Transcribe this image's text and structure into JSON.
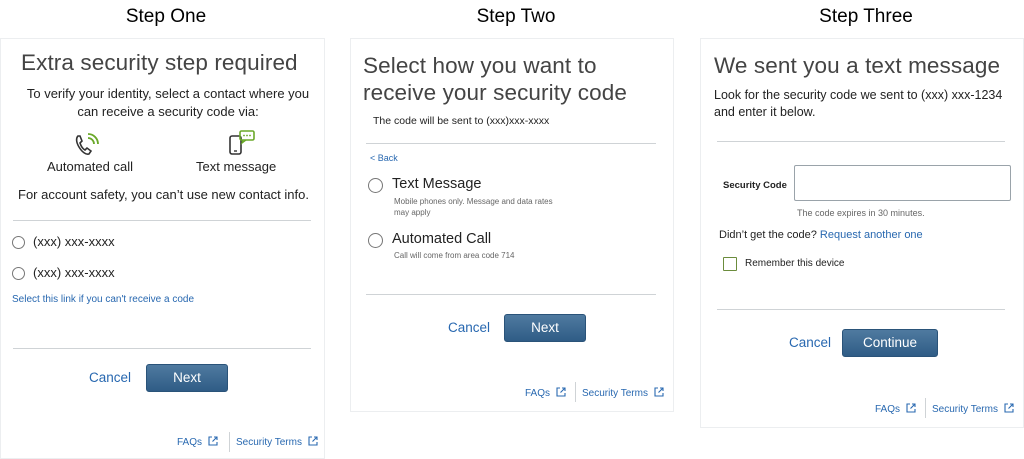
{
  "headings": {
    "step1": "Step One",
    "step2": "Step Two",
    "step3": "Step Three"
  },
  "step1": {
    "title": "Extra security step required",
    "intro": "To verify your identity, select a contact where you can receive a security code via:",
    "call_label": "Automated call",
    "text_label": "Text message",
    "safety_note": "For account safety, you can’t use new contact info.",
    "contact1": "(xxx) xxx-xxxx",
    "contact2": "(xxx) xxx-xxxx",
    "cant_receive_link": "Select this link if you can't receive a code",
    "cancel": "Cancel",
    "next": "Next",
    "faqs": "FAQs",
    "security_terms": "Security Terms"
  },
  "step2": {
    "title": "Select how you want to receive your security code",
    "sent_to": "The code will be sent to (xxx)xxx-xxxx",
    "back": "< Back",
    "opt1_label": "Text Message",
    "opt1_desc": "Mobile phones only. Message and data rates may apply",
    "opt2_label": "Automated Call",
    "opt2_desc": "Call will come from area code 714",
    "cancel": "Cancel",
    "next": "Next",
    "faqs": "FAQs",
    "security_terms": "Security Terms"
  },
  "step3": {
    "title": "We sent you a text message",
    "intro": "Look for the security code we sent to (xxx) xxx-1234 and enter it below.",
    "code_label": "Security Code",
    "code_value": "",
    "expires": "The code expires in 30 minutes.",
    "didnt_get": "Didn’t get the code?",
    "request_link": "Request another one",
    "remember": "Remember this device",
    "cancel": "Cancel",
    "continue": "Continue",
    "faqs": "FAQs",
    "security_terms": "Security Terms"
  },
  "colors": {
    "link": "#2868b0",
    "primary_button": "#3a6891",
    "icon_green": "#6aa829"
  },
  "icons": [
    "phone-call-icon",
    "mobile-message-icon",
    "external-link-icon"
  ]
}
